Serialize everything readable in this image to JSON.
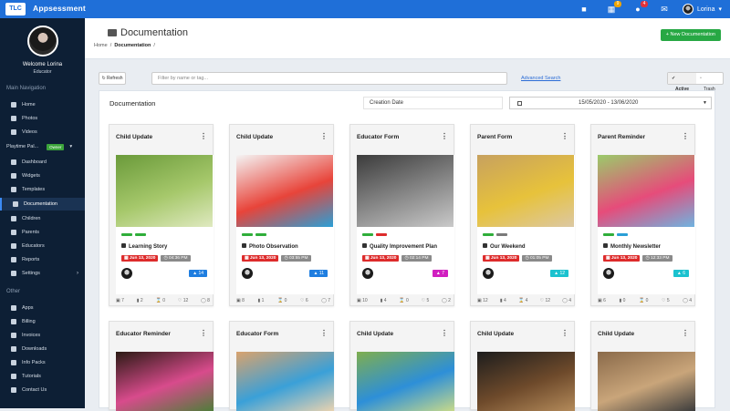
{
  "app": {
    "brand": "Appsessment",
    "logo_text": "TLC"
  },
  "topbar": {
    "user_name": "Lorina",
    "notifications_count": "4",
    "calendar_badge": "9",
    "colors": {
      "bar": "#1f6fd8"
    }
  },
  "sidebar": {
    "welcome": "Welcome Lorina",
    "role": "Educator",
    "main_nav_heading": "Main Navigation",
    "main_items": [
      {
        "label": "Home",
        "icon": "home-icon"
      },
      {
        "label": "Photos",
        "icon": "camera-icon"
      },
      {
        "label": "Videos",
        "icon": "video-icon"
      }
    ],
    "center": {
      "label": "Playtime Pal...",
      "badge": "Owner"
    },
    "center_items": [
      {
        "label": "Dashboard",
        "icon": "dashboard-icon"
      },
      {
        "label": "Widgets",
        "icon": "widgets-icon"
      },
      {
        "label": "Templates",
        "icon": "templates-icon"
      },
      {
        "label": "Documentation",
        "icon": "document-icon",
        "active": true
      },
      {
        "label": "Children",
        "icon": "child-icon"
      },
      {
        "label": "Parents",
        "icon": "parents-icon"
      },
      {
        "label": "Educators",
        "icon": "educators-icon"
      },
      {
        "label": "Reports",
        "icon": "reports-icon"
      },
      {
        "label": "Settings",
        "icon": "gear-icon"
      }
    ],
    "other_heading": "Other",
    "other_items": [
      {
        "label": "Apps",
        "icon": "apps-icon"
      },
      {
        "label": "Billing",
        "icon": "billing-icon"
      },
      {
        "label": "Invoices",
        "icon": "invoice-icon"
      },
      {
        "label": "Downloads",
        "icon": "download-icon"
      },
      {
        "label": "Info Packs",
        "icon": "info-icon"
      },
      {
        "label": "Tutorials",
        "icon": "tutorial-icon"
      },
      {
        "label": "Contact Us",
        "icon": "mail-icon"
      }
    ]
  },
  "header": {
    "title": "Documentation",
    "breadcrumb_home": "Home",
    "breadcrumb_current": "Documentation",
    "new_button": "New Documentation"
  },
  "toolbar": {
    "refresh": "Refresh",
    "search_placeholder": "Filter by name or tag...",
    "advanced_search": "Advanced Search",
    "active": "Active",
    "trash": "Trash"
  },
  "panel": {
    "title": "Documentation",
    "sort_field": "Creation Date",
    "date_range": "15/05/2020 - 13/06/2020"
  },
  "cards": [
    {
      "type": "Child Update",
      "title": "Learning Story",
      "date": "Jun 13, 2020",
      "time": "04:36 PM",
      "count": "14",
      "count_color": "#1f7ee0",
      "bars": [
        "#2fae3a",
        "#2fae3a"
      ],
      "stats": [
        "7",
        "2",
        "0",
        "12",
        "8"
      ],
      "thumb_colors": [
        "#6a9a3a",
        "#a6c86b",
        "#dfe9c0"
      ]
    },
    {
      "type": "Child Update",
      "title": "Photo Observation",
      "date": "Jun 13, 2020",
      "time": "03:55 PM",
      "count": "11",
      "count_color": "#1f7ee0",
      "bars": [
        "#2fae3a",
        "#2fae3a"
      ],
      "stats": [
        "8",
        "1",
        "0",
        "6",
        "7"
      ],
      "thumb_colors": [
        "#f4f4f4",
        "#e8443a",
        "#2a9fd6"
      ]
    },
    {
      "type": "Educator Form",
      "title": "Quality Improvement Plan",
      "date": "Jun 13, 2020",
      "time": "02:14 PM",
      "count": "7",
      "count_color": "#d11fc0",
      "bars": [
        "#2fae3a",
        "#dd2b2b"
      ],
      "stats": [
        "10",
        "4",
        "0",
        "5",
        "2"
      ],
      "thumb_colors": [
        "#3b3b3b",
        "#8a8a8a",
        "#c9c9c9"
      ]
    },
    {
      "type": "Parent Form",
      "title": "Our Weekend",
      "date": "Jun 13, 2020",
      "time": "01:05 PM",
      "count": "12",
      "count_color": "#1bc2cf",
      "bars": [
        "#2fae3a",
        "#7a7a7a"
      ],
      "stats": [
        "12",
        "4",
        "4",
        "12",
        "4"
      ],
      "thumb_colors": [
        "#c7a15f",
        "#e7c23b",
        "#dcc8a3"
      ]
    },
    {
      "type": "Parent Reminder",
      "title": "Monthly Newsletter",
      "date": "Jun 13, 2020",
      "time": "12:33 PM",
      "count": "6",
      "count_color": "#1bc2cf",
      "bars": [
        "#2fae3a",
        "#2a9fd6"
      ],
      "stats": [
        "6",
        "0",
        "0",
        "5",
        "4"
      ],
      "thumb_colors": [
        "#9acb6a",
        "#e64c7a",
        "#6fb3e0"
      ]
    }
  ],
  "cards_row2": [
    {
      "type": "Educator Reminder",
      "thumb_colors": [
        "#2b1a14",
        "#d84b8c",
        "#4f7d3a"
      ]
    },
    {
      "type": "Educator Form",
      "thumb_colors": [
        "#d9a26d",
        "#3aa0d8",
        "#e9d2b0"
      ]
    },
    {
      "type": "Child Update",
      "thumb_colors": [
        "#7fae4f",
        "#2d8fd8",
        "#c7d98a"
      ]
    },
    {
      "type": "Child Update",
      "thumb_colors": [
        "#1d1d1d",
        "#6e4a2b",
        "#b38a5a"
      ]
    },
    {
      "type": "Child Update",
      "thumb_colors": [
        "#8a6a4a",
        "#c9a57a",
        "#3d3d3d"
      ]
    }
  ]
}
